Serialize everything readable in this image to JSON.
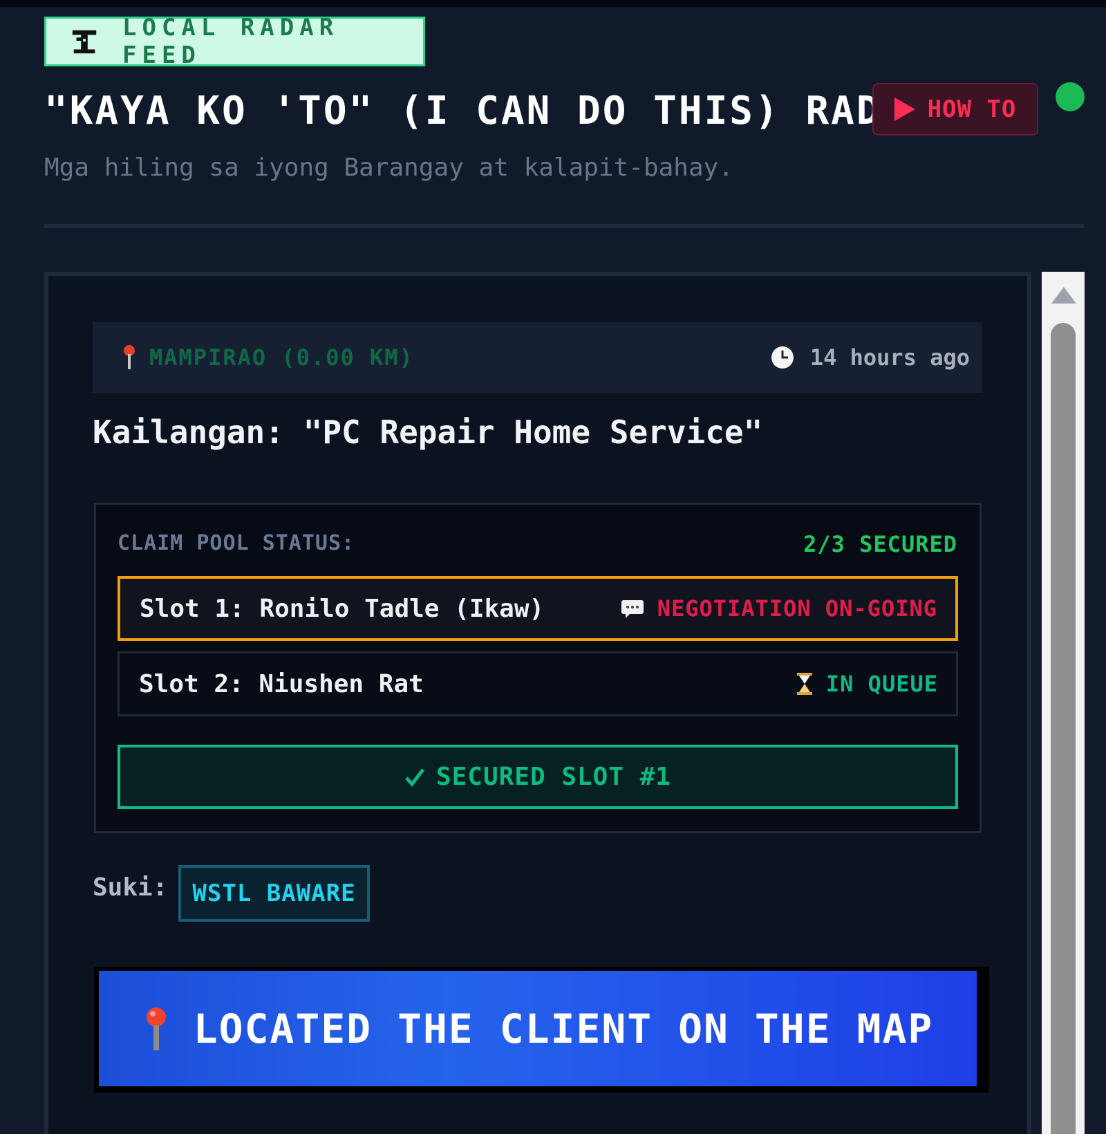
{
  "header": {
    "feed_tag": "LOCAL RADAR FEED",
    "title": "\"KAYA KO 'TO\" (I CAN DO THIS) RADAR",
    "howto_label": "HOW TO",
    "subtitle": "Mga hiling sa iyong Barangay at kalapit-bahay.",
    "status_color": "#1db954"
  },
  "request_card": {
    "location": "MAMPIRAO (0.00 KM)",
    "posted": "14 hours ago",
    "need_title": "Kailangan: \"PC Repair Home Service\"",
    "claim_pool": {
      "label": "CLAIM POOL STATUS:",
      "secured_count": "2/3 SECURED",
      "slots": [
        {
          "name": "Slot 1: Ronilo Tadle (Ikaw)",
          "status": "NEGOTIATION ON-GOING",
          "status_icon": "chat-icon",
          "highlight_color": "#f59e0b"
        },
        {
          "name": "Slot 2: Niushen Rat",
          "status": "IN QUEUE",
          "status_icon": "hourglass-icon"
        }
      ],
      "secured_button": "SECURED SLOT #1"
    },
    "suki_label": "Suki:",
    "suki_name": "WSTL BAWARE",
    "map_button": "LOCATED THE CLIENT ON THE MAP"
  },
  "colors": {
    "background": "#111a2b",
    "accent_green": "#10b981",
    "accent_red": "#e11d48",
    "accent_blue": "#2563eb",
    "accent_cyan": "#22d3ee"
  }
}
